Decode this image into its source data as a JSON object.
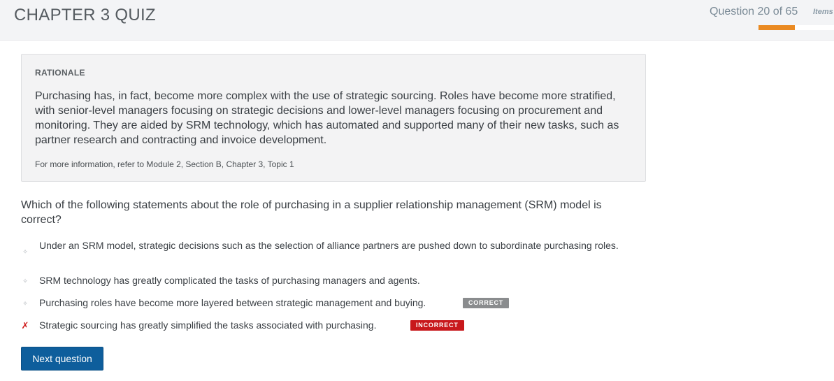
{
  "header": {
    "title": "CHAPTER 3 QUIZ",
    "progress_text": "Question 20 of 65",
    "items_label": "Items",
    "progress_fraction": 0.48,
    "accent_color": "#ea8a22"
  },
  "rationale": {
    "heading": "RATIONALE",
    "body": "Purchasing has, in fact, become more complex with the use of strategic sourcing. Roles have become more stratified, with senior-level managers focusing on strategic decisions and lower-level managers focusing on procurement and monitoring. They are aided by SRM technology, which has automated and supported many of their new tasks, such as partner research and contracting and invoice development.",
    "reference": "For more information, refer to Module 2, Section B, Chapter 3, Topic 1"
  },
  "question": {
    "text": "Which of the following statements about the role of purchasing in a supplier relationship management (SRM) model is correct?"
  },
  "options": [
    {
      "text": "Under an SRM model, strategic decisions such as the selection of alliance partners are pushed down to subordinate purchasing roles.",
      "marker": "✧",
      "badge": ""
    },
    {
      "text": "SRM technology has greatly complicated the tasks of purchasing managers and agents.",
      "marker": "✧",
      "badge": ""
    },
    {
      "text": "Purchasing roles have become more layered between strategic management and buying.",
      "marker": "✧",
      "badge": "CORRECT"
    },
    {
      "text": "Strategic sourcing has greatly simplified the tasks associated with purchasing.",
      "marker": "✗",
      "badge": "INCORRECT"
    }
  ],
  "buttons": {
    "next_label": "Next question"
  },
  "colors": {
    "correct_badge": "#8a8c8e",
    "incorrect_badge": "#c8181c",
    "wrong_marker": "#d01f1f",
    "primary_button": "#0e5e9c"
  }
}
